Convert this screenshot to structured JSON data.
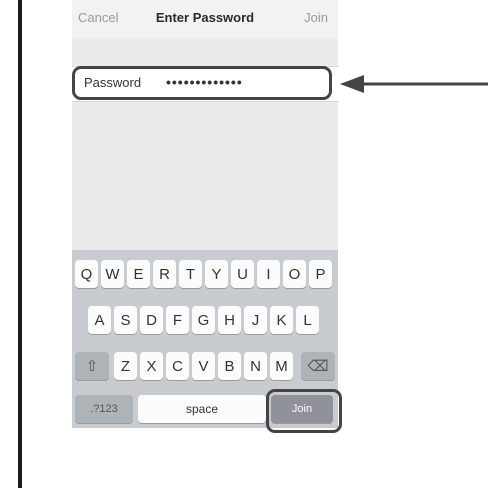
{
  "nav": {
    "cancel": "Cancel",
    "title": "Enter Password",
    "join": "Join"
  },
  "field": {
    "label": "Password",
    "value": "•••••••••••••"
  },
  "keyboard": {
    "row1": [
      "Q",
      "W",
      "E",
      "R",
      "T",
      "Y",
      "U",
      "I",
      "O",
      "P"
    ],
    "row2": [
      "A",
      "S",
      "D",
      "F",
      "G",
      "H",
      "J",
      "K",
      "L"
    ],
    "row3": [
      "Z",
      "X",
      "C",
      "V",
      "B",
      "N",
      "M"
    ],
    "shift": "⇧",
    "delete": "⌫",
    "numbers": ".?123",
    "space": "space",
    "join": "Join"
  }
}
